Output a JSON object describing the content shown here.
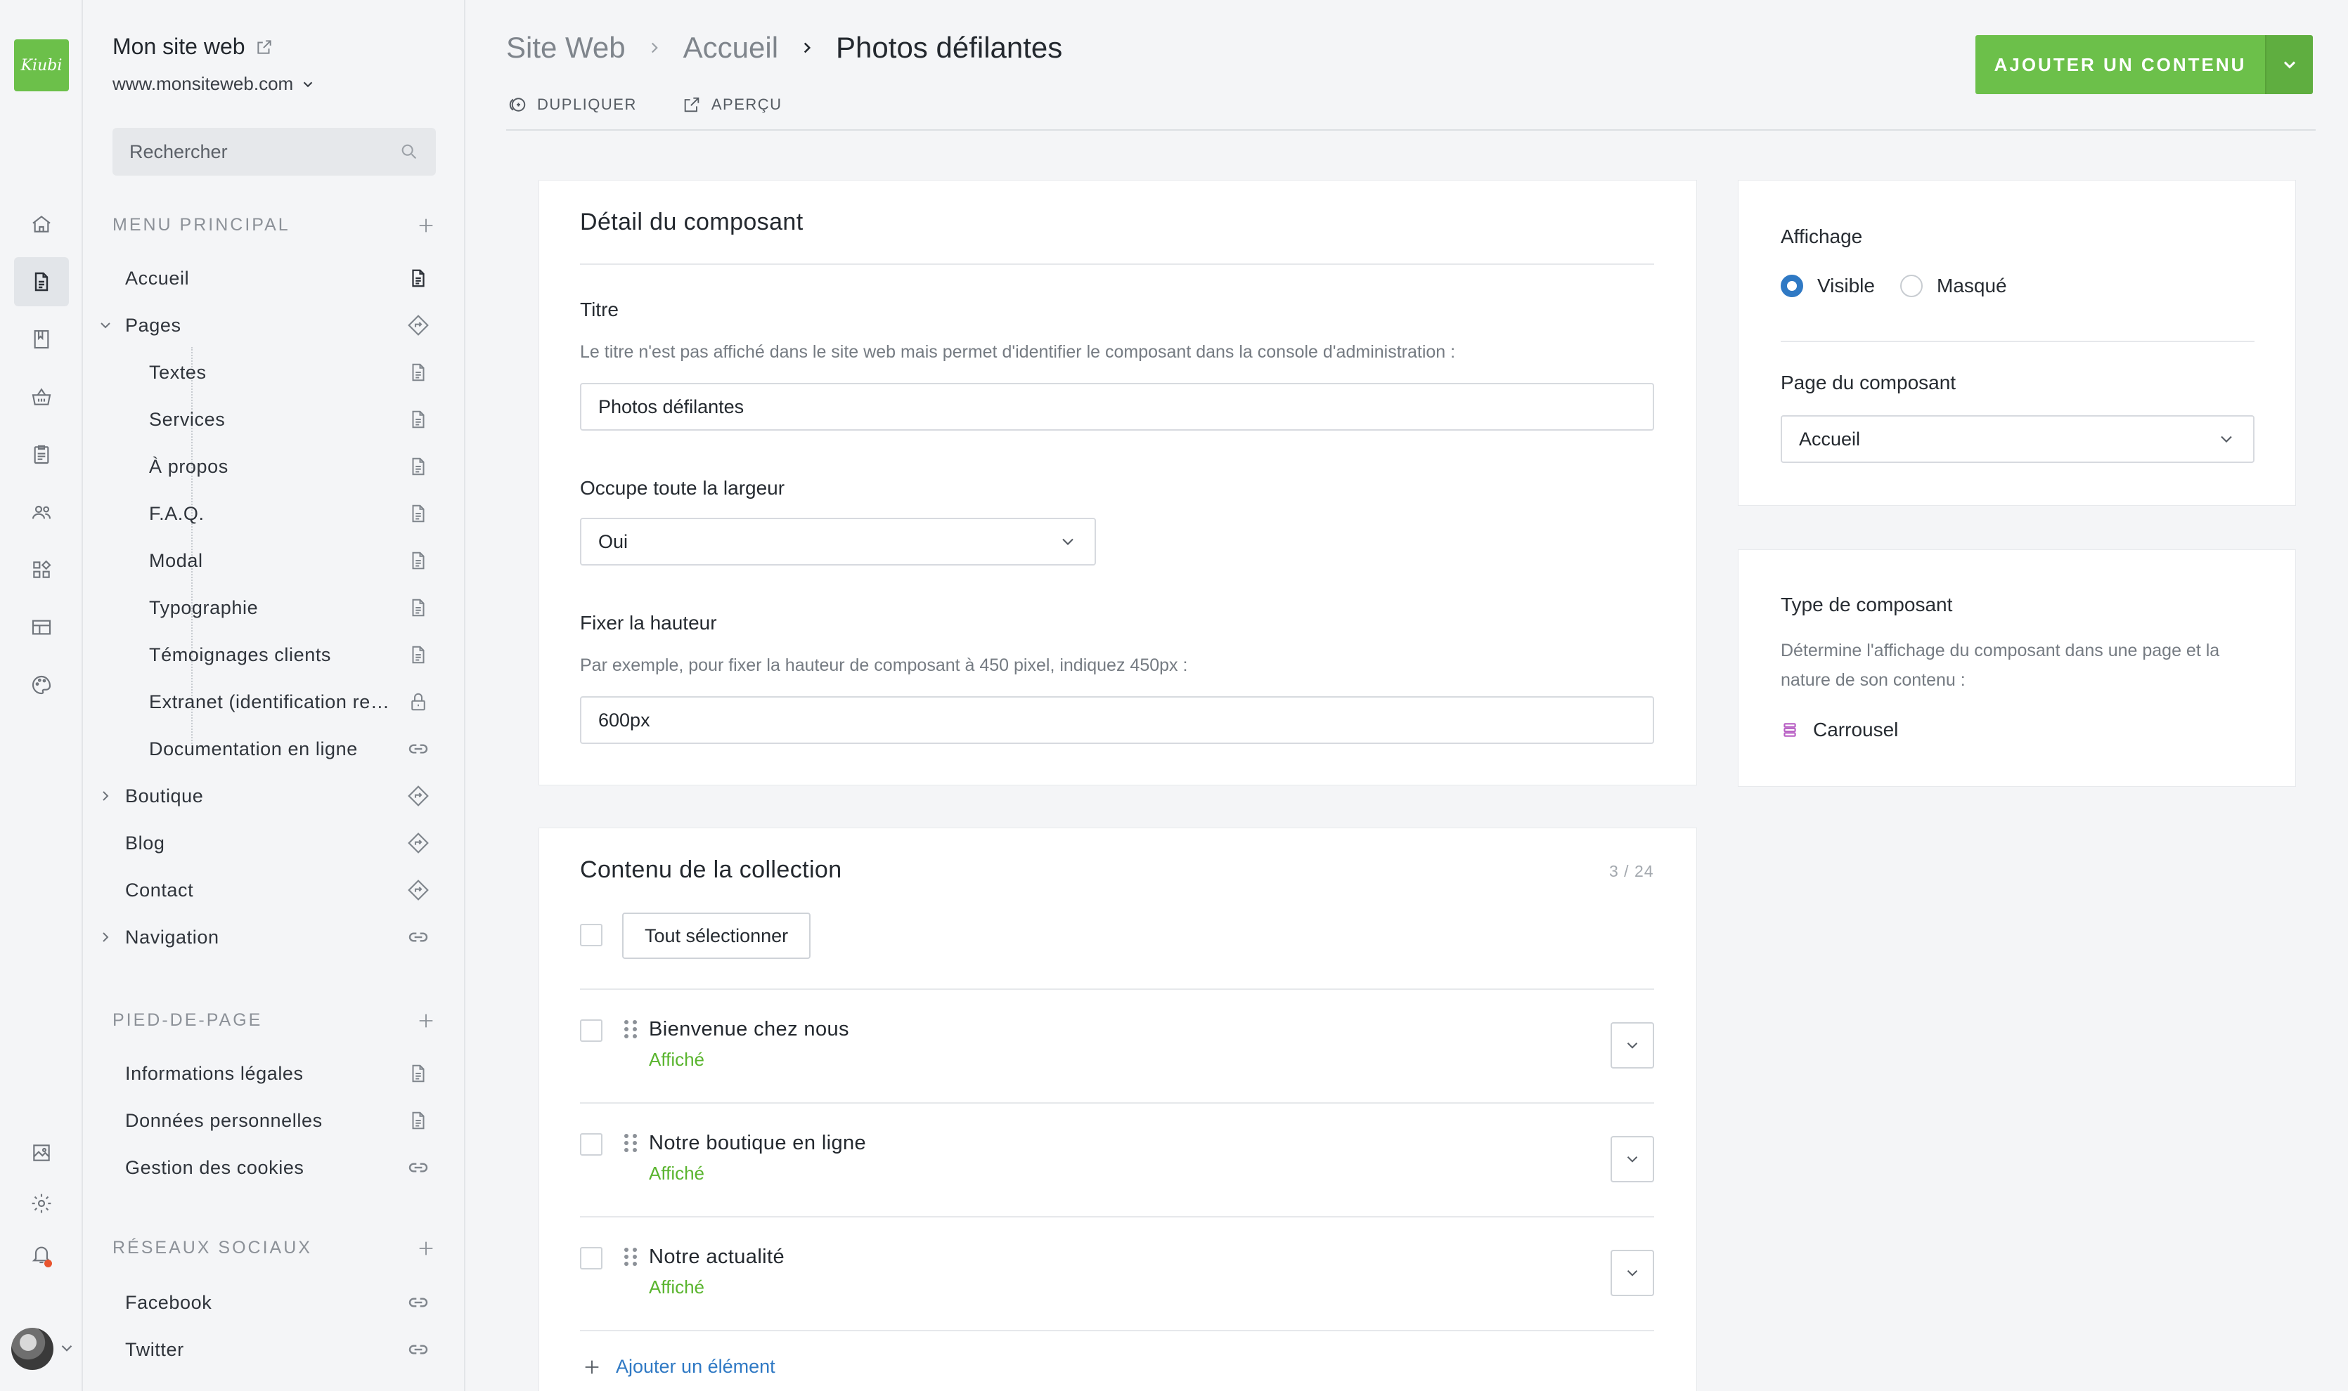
{
  "logo": {
    "text": "Kiubi"
  },
  "site": {
    "title": "Mon site web",
    "url": "www.monsiteweb.com"
  },
  "search": {
    "placeholder": "Rechercher"
  },
  "menu_principal": {
    "heading": "MENU PRINCIPAL",
    "items": [
      {
        "label": "Accueil",
        "icon": "page-icon"
      },
      {
        "label": "Pages",
        "icon": "signpost-icon"
      },
      {
        "label": "Textes",
        "icon": "page-icon"
      },
      {
        "label": "Services",
        "icon": "page-icon"
      },
      {
        "label": "À propos",
        "icon": "page-icon"
      },
      {
        "label": "F.A.Q.",
        "icon": "page-icon"
      },
      {
        "label": "Modal",
        "icon": "page-icon"
      },
      {
        "label": "Typographie",
        "icon": "page-icon"
      },
      {
        "label": "Témoignages clients",
        "icon": "page-icon"
      },
      {
        "label": "Extranet (identification requise)",
        "icon": "lock-icon"
      },
      {
        "label": "Documentation en ligne",
        "icon": "link-icon"
      },
      {
        "label": "Boutique",
        "icon": "signpost-icon"
      },
      {
        "label": "Blog",
        "icon": "signpost-icon"
      },
      {
        "label": "Contact",
        "icon": "signpost-icon"
      },
      {
        "label": "Navigation",
        "icon": "link-icon"
      }
    ]
  },
  "pied_de_page": {
    "heading": "PIED-DE-PAGE",
    "items": [
      {
        "label": "Informations légales",
        "icon": "page-icon"
      },
      {
        "label": "Données personnelles",
        "icon": "page-icon"
      },
      {
        "label": "Gestion des cookies",
        "icon": "link-icon"
      }
    ]
  },
  "reseaux_sociaux": {
    "heading": "RÉSEAUX SOCIAUX",
    "items": [
      {
        "label": "Facebook",
        "icon": "link-icon"
      },
      {
        "label": "Twitter",
        "icon": "link-icon"
      }
    ]
  },
  "breadcrumb": [
    "Site Web",
    "Accueil",
    "Photos défilantes"
  ],
  "header_actions": {
    "duplicate": "DUPLIQUER",
    "preview": "APERÇU"
  },
  "add_button": {
    "label": "AJOUTER UN CONTENU"
  },
  "detail": {
    "title": "Détail du composant",
    "titre_label": "Titre",
    "titre_help": "Le titre n'est pas affiché dans le site web mais permet d'identifier le composant dans la console d'administration :",
    "titre_value": "Photos défilantes",
    "largeur_label": "Occupe toute la largeur",
    "largeur_value": "Oui",
    "hauteur_label": "Fixer la hauteur",
    "hauteur_help": "Par exemple, pour fixer la hauteur de composant à 450 pixel, indiquez 450px :",
    "hauteur_value": "600px"
  },
  "collection": {
    "title": "Contenu de la collection",
    "counter": "3 / 24",
    "select_all": "Tout sélectionner",
    "items": [
      {
        "title": "Bienvenue chez nous",
        "status": "Affiché"
      },
      {
        "title": "Notre boutique en ligne",
        "status": "Affiché"
      },
      {
        "title": "Notre actualité",
        "status": "Affiché"
      }
    ],
    "add_label": "Ajouter un élément"
  },
  "affichage": {
    "label": "Affichage",
    "options": [
      "Visible",
      "Masqué"
    ],
    "selected": "Visible"
  },
  "page_composant": {
    "label": "Page du composant",
    "value": "Accueil"
  },
  "type_composant": {
    "label": "Type de composant",
    "description": "Détermine l'affichage du composant dans une page et la nature de son contenu :",
    "value": "Carrousel"
  },
  "colors": {
    "accent": "#6cc04a",
    "link": "#2f79c4",
    "status": "#5ab52f",
    "notification": "#e8542f"
  }
}
